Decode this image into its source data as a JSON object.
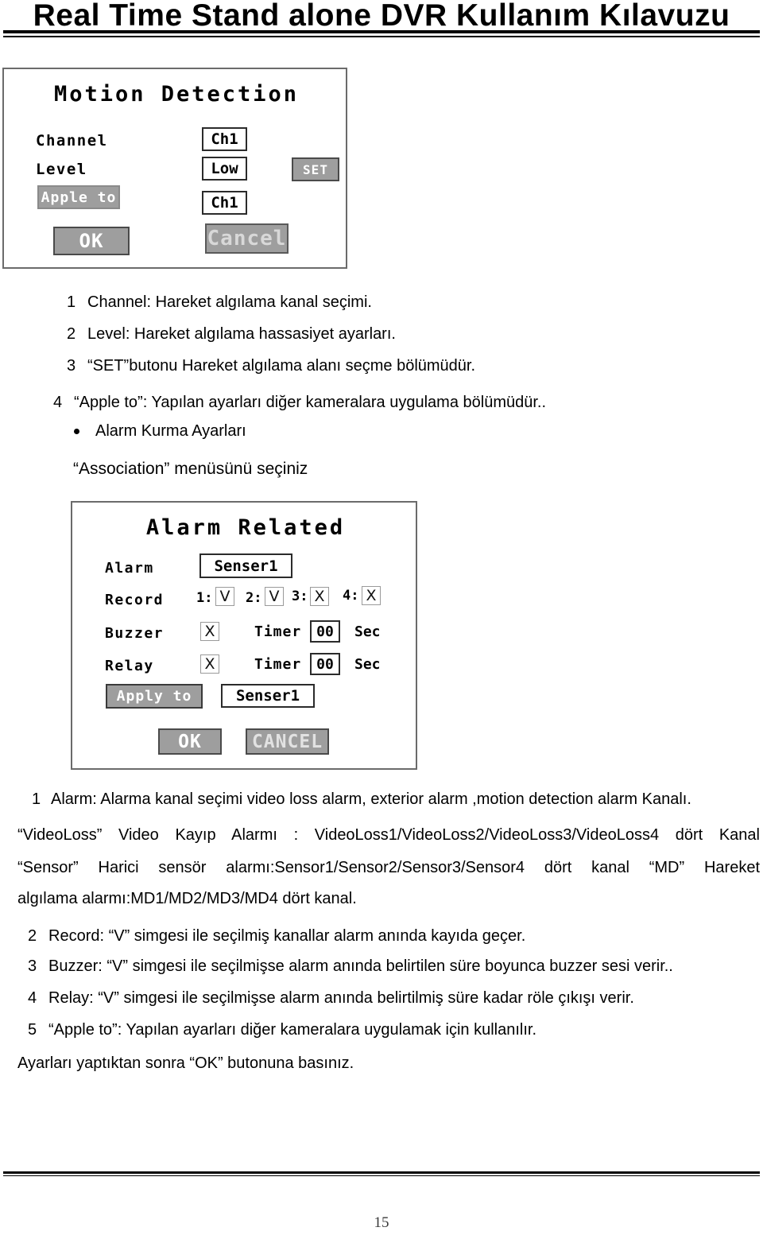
{
  "header": {
    "title": "Real Time Stand alone DVR Kullanım Kılavuzu"
  },
  "motion_detection_dialog": {
    "title": "Motion Detection",
    "labels": {
      "channel": "Channel",
      "level": "Level"
    },
    "fields": {
      "channel_value": "Ch1",
      "level_value": "Low",
      "apply_to_value": "Ch1"
    },
    "buttons": {
      "apply_to": "Apple to",
      "set": "SET",
      "ok": "OK",
      "cancel": "Cancel"
    }
  },
  "motion_detection_notes": [
    {
      "num": "1",
      "text": "Channel: Hareket algılama kanal seçimi."
    },
    {
      "num": "2",
      "text": "Level: Hareket algılama hassasiyet ayarları."
    },
    {
      "num": "3",
      "text": "“SET”butonu  Hareket algılama alanı seçme bölümüdür."
    },
    {
      "num": "4",
      "text": "“Apple to”: Yapılan ayarları diğer kameralara uygulama bölümüdür.."
    }
  ],
  "alarm_section": {
    "bullet_heading": "Alarm Kurma Ayarları",
    "sub_heading": "“Association” menüsünü seçiniz"
  },
  "alarm_related_dialog": {
    "title": "Alarm Related",
    "labels": {
      "alarm": "Alarm",
      "record": "Record",
      "buzzer": "Buzzer",
      "relay": "Relay",
      "timer1": "Timer",
      "timer2": "Timer",
      "sec1": "Sec",
      "sec2": "Sec"
    },
    "fields": {
      "alarm_value": "Senser1",
      "buzzer_timer": "00",
      "relay_timer": "00",
      "apply_to_value": "Senser1"
    },
    "record_channels": [
      {
        "label": "1:",
        "state": "V"
      },
      {
        "label": "2:",
        "state": "V"
      },
      {
        "label": "3:",
        "state": "X"
      },
      {
        "label": "4:",
        "state": "X"
      }
    ],
    "checks": {
      "buzzer_state": "X",
      "relay_state": "X"
    },
    "buttons": {
      "apply_to": "Apply to",
      "ok": "OK",
      "cancel": "CANCEL"
    }
  },
  "alarm_notes": {
    "item1_num": "1",
    "item1_text": "Alarm: Alarma kanal seçimi  video loss alarm, exterior alarm ,motion detection alarm Kanalı.",
    "para_line1": "“VideoLoss” Video Kayıp Alarmı : VideoLoss1/VideoLoss2/VideoLoss3/VideoLoss4 dört Kanal",
    "para_line2": "“Sensor” Harici sensör alarmı:Sensor1/Sensor2/Sensor3/Sensor4 dört kanal    “MD” Hareket",
    "para_line3": "algılama alarmı:MD1/MD2/MD3/MD4 dört kanal.",
    "items": [
      {
        "num": "2",
        "text": "Record: “V” simgesi ile seçilmiş kanallar alarm anında kayıda geçer."
      },
      {
        "num": "3",
        "text": "Buzzer: “V” simgesi ile seçilmişse alarm anında belirtilen süre boyunca buzzer sesi verir.."
      },
      {
        "num": "4",
        "text": "Relay: “V” simgesi ile seçilmişse alarm anında belirtilmiş süre kadar röle çıkışı verir."
      },
      {
        "num": "5",
        "text": " “Apple to”: Yapılan ayarları diğer kameralara uygulamak için kullanılır."
      }
    ],
    "closing": "Ayarları yaptıktan sonra “OK” butonuna basınız."
  },
  "footer": {
    "page_number": "15"
  },
  "colors": {
    "button_gray": "#9e9e9e",
    "dialog_border": "#6b6b6b",
    "text_black": "#000000"
  }
}
